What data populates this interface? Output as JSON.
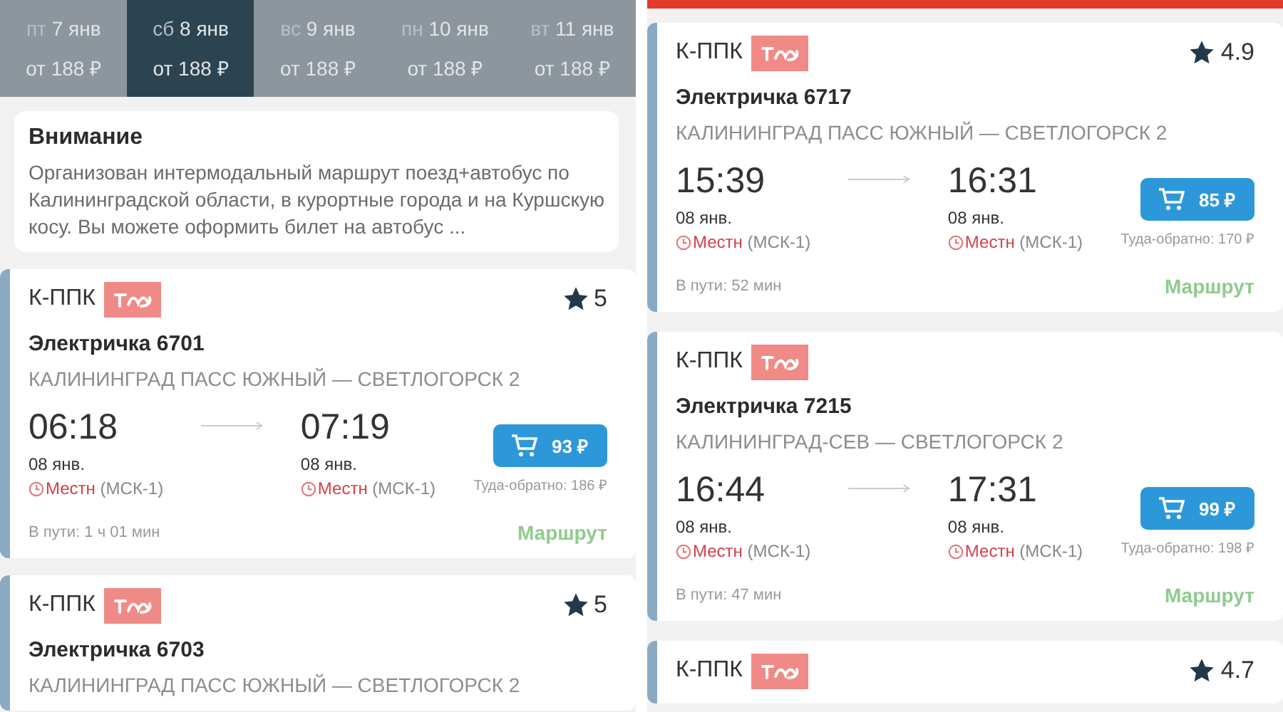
{
  "left": {
    "dates": [
      {
        "weekday": "пт",
        "date": "7 янв",
        "price": "от 188 ₽",
        "selected": false
      },
      {
        "weekday": "сб",
        "date": "8 янв",
        "price": "от 188 ₽",
        "selected": true
      },
      {
        "weekday": "вс",
        "date": "9 янв",
        "price": "от 188 ₽",
        "selected": false
      },
      {
        "weekday": "пн",
        "date": "10 янв",
        "price": "от 188 ₽",
        "selected": false
      },
      {
        "weekday": "вт",
        "date": "11 янв",
        "price": "от 188 ₽",
        "selected": false
      }
    ],
    "notice": {
      "title": "Внимание",
      "text": "Организован интермодальный маршрут поезд+автобус по Калининградской области, в курортные города и на Куршскую косу. Вы можете оформить билет на автобус ..."
    },
    "trains": [
      {
        "carrier": "К-ППК",
        "rating": "5",
        "name": "Электричка 6701",
        "route": "КАЛИНИНГРАД ПАСС ЮЖНЫЙ — СВЕТЛОГОРСК 2",
        "depart": {
          "time": "06:18",
          "date": "08 янв.",
          "zone_label": "Местн",
          "zone": "(МСК-1)"
        },
        "arrive": {
          "time": "07:19",
          "date": "08 янв.",
          "zone_label": "Местн",
          "zone": "(МСК-1)"
        },
        "price": "93 ₽",
        "round_trip": "Туда-обратно: 186 ₽",
        "duration": "В пути: 1 ч 01 мин",
        "route_link": "Маршрут"
      },
      {
        "carrier": "К-ППК",
        "rating": "5",
        "name": "Электричка 6703",
        "route": "КАЛИНИНГРАД ПАСС ЮЖНЫЙ — СВЕТЛОГОРСК 2"
      }
    ]
  },
  "right": {
    "trains": [
      {
        "carrier": "К-ППК",
        "rating": "4.9",
        "name": "Электричка 6717",
        "route": "КАЛИНИНГРАД ПАСС ЮЖНЫЙ — СВЕТЛОГОРСК 2",
        "depart": {
          "time": "15:39",
          "date": "08 янв.",
          "zone_label": "Местн",
          "zone": "(МСК-1)"
        },
        "arrive": {
          "time": "16:31",
          "date": "08 янв.",
          "zone_label": "Местн",
          "zone": "(МСК-1)"
        },
        "price": "85 ₽",
        "round_trip": "Туда-обратно: 170 ₽",
        "duration": "В пути: 52 мин",
        "route_link": "Маршрут"
      },
      {
        "carrier": "К-ППК",
        "name": "Электричка 7215",
        "route": "КАЛИНИНГРАД-СЕВ — СВЕТЛОГОРСК 2",
        "depart": {
          "time": "16:44",
          "date": "08 янв.",
          "zone_label": "Местн",
          "zone": "(МСК-1)"
        },
        "arrive": {
          "time": "17:31",
          "date": "08 янв.",
          "zone_label": "Местн",
          "zone": "(МСК-1)"
        },
        "price": "99 ₽",
        "round_trip": "Туда-обратно: 198 ₽",
        "duration": "В пути: 47 мин",
        "route_link": "Маршрут"
      },
      {
        "carrier": "К-ППК",
        "rating": "4.7"
      }
    ]
  }
}
